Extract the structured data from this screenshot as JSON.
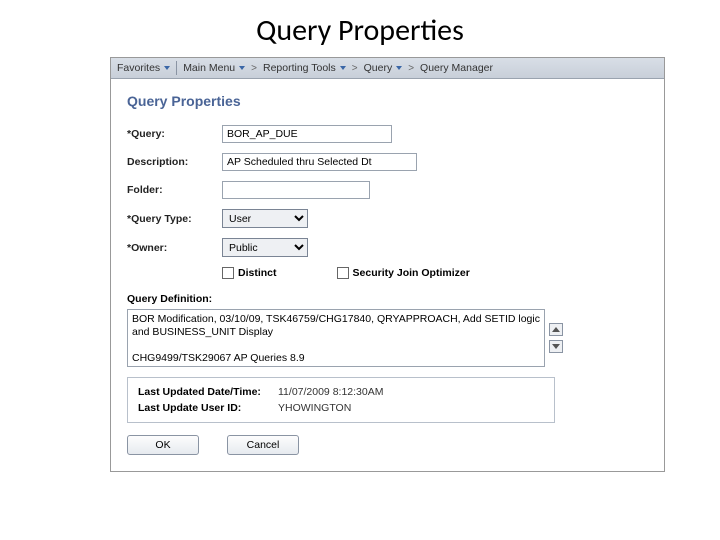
{
  "slide": {
    "title": "Query Properties"
  },
  "breadcrumb": {
    "favorites": "Favorites",
    "main_menu": "Main Menu",
    "reporting_tools": "Reporting Tools",
    "query": "Query",
    "query_manager": "Query Manager"
  },
  "page": {
    "heading": "Query Properties"
  },
  "form": {
    "labels": {
      "query": "*Query:",
      "description": "Description:",
      "folder": "Folder:",
      "query_type": "*Query Type:",
      "owner": "*Owner:",
      "distinct": "Distinct",
      "security_join": "Security Join Optimizer",
      "query_definition": "Query Definition:"
    },
    "values": {
      "query": "BOR_AP_DUE",
      "description": "AP Scheduled thru Selected Dt",
      "folder": "",
      "query_type": "User",
      "owner": "Public",
      "definition": "BOR Modification, 03/10/09, TSK46759/CHG17840, QRYAPPROACH, Add SETID logic and BUSINESS_UNIT Display\n\nCHG9499/TSK29067 AP Queries 8.9"
    }
  },
  "meta": {
    "labels": {
      "updated_dt": "Last Updated Date/Time:",
      "updated_user": "Last Update User ID:"
    },
    "values": {
      "updated_dt": "11/07/2009  8:12:30AM",
      "updated_user": "YHOWINGTON"
    }
  },
  "buttons": {
    "ok": "OK",
    "cancel": "Cancel"
  }
}
